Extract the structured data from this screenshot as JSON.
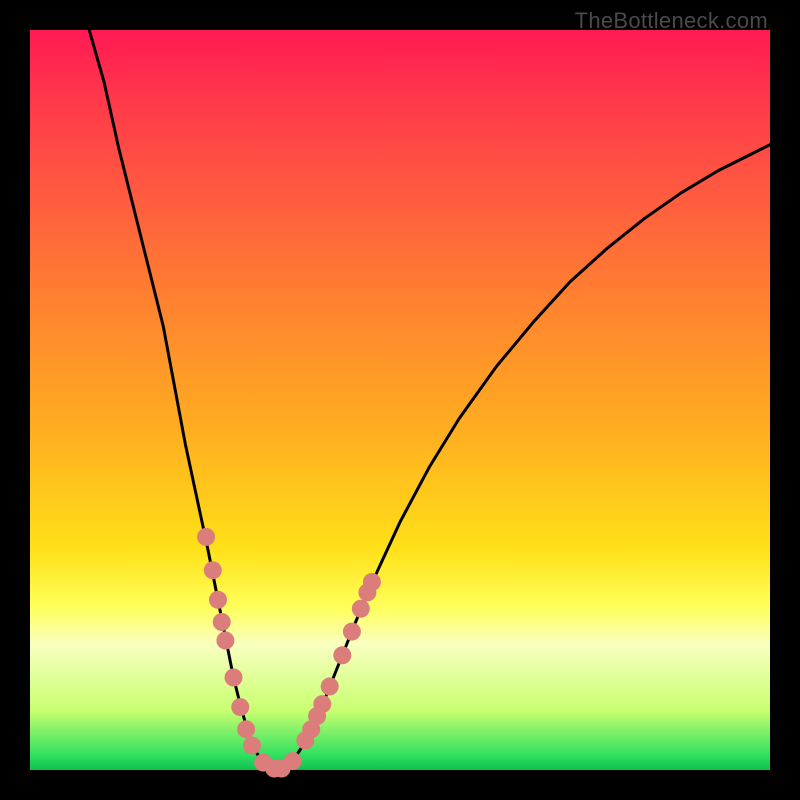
{
  "watermark": "TheBottleneck.com",
  "chart_data": {
    "type": "line",
    "title": "",
    "xlabel": "",
    "ylabel": "",
    "xlim": [
      0,
      100
    ],
    "ylim": [
      0,
      100
    ],
    "grid": false,
    "legend": false,
    "curve_points": [
      [
        8,
        100
      ],
      [
        10,
        93
      ],
      [
        12,
        84
      ],
      [
        14,
        76
      ],
      [
        16,
        68
      ],
      [
        18,
        60
      ],
      [
        19.5,
        52
      ],
      [
        21,
        44
      ],
      [
        22.5,
        37
      ],
      [
        24,
        30
      ],
      [
        25.3,
        23.5
      ],
      [
        26.5,
        17.5
      ],
      [
        27.5,
        12.5
      ],
      [
        28.5,
        8.5
      ],
      [
        29.5,
        5
      ],
      [
        30.5,
        2.5
      ],
      [
        31.5,
        1
      ],
      [
        32.5,
        0.3
      ],
      [
        33.5,
        0
      ],
      [
        34.5,
        0.3
      ],
      [
        35.5,
        1.2
      ],
      [
        37,
        3.5
      ],
      [
        38.5,
        6.5
      ],
      [
        40,
        10
      ],
      [
        42,
        15
      ],
      [
        44,
        20
      ],
      [
        47,
        27
      ],
      [
        50,
        33.5
      ],
      [
        54,
        41
      ],
      [
        58,
        47.5
      ],
      [
        63,
        54.5
      ],
      [
        68,
        60.5
      ],
      [
        73,
        66
      ],
      [
        78,
        70.5
      ],
      [
        83,
        74.5
      ],
      [
        88,
        78
      ],
      [
        93,
        81
      ],
      [
        98,
        83.5
      ],
      [
        100,
        84.5
      ]
    ],
    "markers": [
      [
        23.8,
        31.5
      ],
      [
        24.7,
        27
      ],
      [
        25.4,
        23
      ],
      [
        25.9,
        20
      ],
      [
        26.4,
        17.5
      ],
      [
        27.5,
        12.5
      ],
      [
        28.4,
        8.5
      ],
      [
        29.2,
        5.5
      ],
      [
        30.0,
        3.3
      ],
      [
        31.5,
        1
      ],
      [
        33,
        0.2
      ],
      [
        34,
        0.2
      ],
      [
        35.5,
        1.2
      ],
      [
        37.2,
        4
      ],
      [
        38.0,
        5.5
      ],
      [
        38.8,
        7.3
      ],
      [
        39.5,
        8.9
      ],
      [
        40.5,
        11.3
      ],
      [
        42.2,
        15.5
      ],
      [
        43.5,
        18.7
      ],
      [
        44.7,
        21.8
      ],
      [
        45.6,
        24
      ],
      [
        46.2,
        25.4
      ]
    ]
  }
}
